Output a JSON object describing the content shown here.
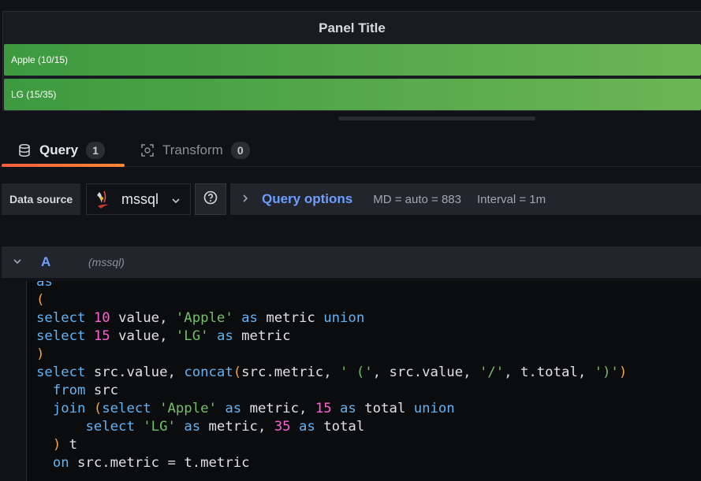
{
  "panel": {
    "title": "Panel Title",
    "bars": [
      {
        "label": "Apple (10/15)",
        "value": 10,
        "max": 15,
        "color_start": "#3d9a3f",
        "color_end": "#6cb556"
      },
      {
        "label": "LG (15/35)",
        "value": 15,
        "max": 35,
        "color_start": "#3d9a3f",
        "color_end": "#6cb556"
      }
    ]
  },
  "tabs": [
    {
      "label": "Query",
      "count": "1",
      "icon": "database-icon",
      "active": true
    },
    {
      "label": "Transform",
      "count": "0",
      "icon": "transform-icon",
      "active": false
    }
  ],
  "toolbar": {
    "datasource_label": "Data source",
    "datasource_value": "mssql",
    "help_icon": "question-circle-icon",
    "query_options_label": "Query options",
    "max_data_points": "MD = auto = 883",
    "interval": "Interval = 1m"
  },
  "query_row": {
    "ref_id": "A",
    "datasource": "(mssql)"
  },
  "editor": {
    "lines": [
      "as",
      "(",
      "select 10 value, 'Apple' as metric union",
      "select 15 value, 'LG' as metric",
      ")",
      "select src.value, concat(src.metric, ' (', src.value, '/', t.total, ')')",
      "  from src",
      "  join (select 'Apple' as metric, 15 as total union",
      "      select 'LG' as metric, 35 as total",
      "  ) t",
      "  on src.metric = t.metric"
    ]
  },
  "colors": {
    "accent_blue": "#6e9fff",
    "tab_underline": "#f55f3e",
    "bar_green": "#4fa846"
  }
}
